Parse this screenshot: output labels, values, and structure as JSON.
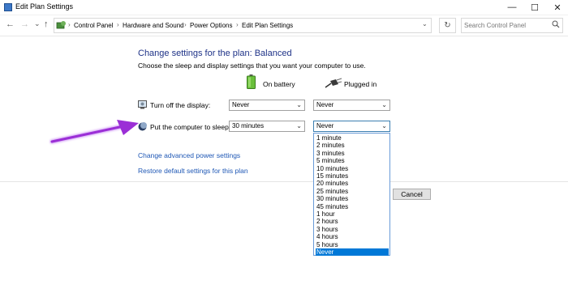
{
  "window": {
    "title": "Edit Plan Settings",
    "controls": {
      "minimize": "—",
      "maximize": "☐",
      "close": "✕"
    }
  },
  "nav": {
    "back": "←",
    "forward": "→",
    "recent": "⌄",
    "up": "↑",
    "breadcrumbs": [
      "Control Panel",
      "Hardware and Sound",
      "Power Options",
      "Edit Plan Settings"
    ],
    "separator": "›",
    "dropdown": "⌄",
    "refresh": "↻",
    "search_placeholder": "Search Control Panel",
    "search_icon": "search-icon"
  },
  "content": {
    "heading": "Change settings for the plan: Balanced",
    "subheading": "Choose the sleep and display settings that you want your computer to use.",
    "col_battery": "On battery",
    "col_plugged": "Plugged in",
    "rows": [
      {
        "label": "Turn off the display:",
        "battery_value": "Never",
        "plugged_value": "Never",
        "icon": "monitor-icon"
      },
      {
        "label": "Put the computer to sleep:",
        "battery_value": "30 minutes",
        "plugged_value": "Never",
        "icon": "moon-icon"
      }
    ],
    "link_advanced": "Change advanced power settings",
    "link_restore": "Restore default settings for this plan",
    "cancel_button": "Cancel"
  },
  "dropdown": {
    "options": [
      "1 minute",
      "2 minutes",
      "3 minutes",
      "5 minutes",
      "10 minutes",
      "15 minutes",
      "20 minutes",
      "25 minutes",
      "30 minutes",
      "45 minutes",
      "1 hour",
      "2 hours",
      "3 hours",
      "4 hours",
      "5 hours",
      "Never"
    ],
    "selected": "Never"
  },
  "colors": {
    "heading": "#1e3287",
    "link": "#1e57b5",
    "selection": "#0078d7",
    "arrow": "#9b2fd6"
  }
}
